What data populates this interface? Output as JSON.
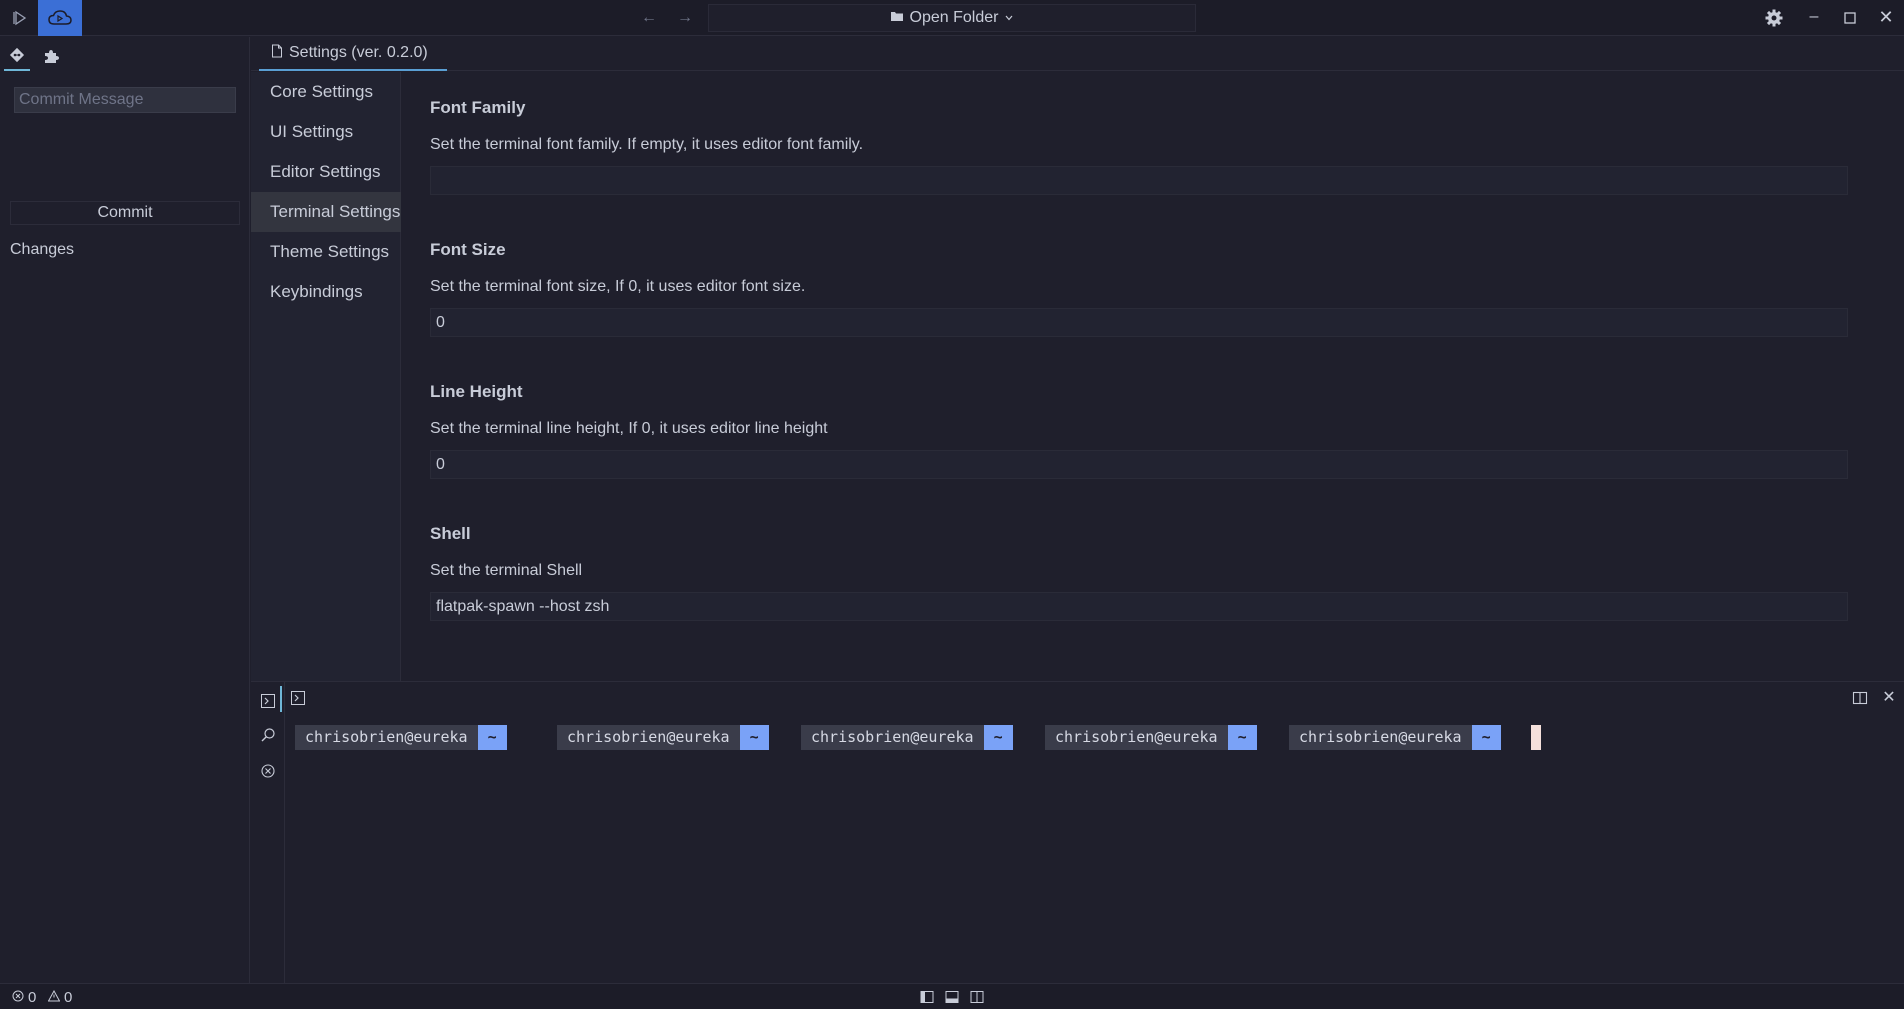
{
  "titlebar": {
    "folder_label": "Open Folder",
    "icons": [
      "run-icon",
      "remote-icon",
      "back-arrow-icon",
      "forward-arrow-icon",
      "folder-icon",
      "chevron-down-icon",
      "gear-icon",
      "minimize-icon",
      "maximize-icon",
      "close-icon"
    ]
  },
  "sidebar": {
    "commit_placeholder": "Commit Message",
    "commit_label": "Commit",
    "changes_label": "Changes"
  },
  "editor": {
    "tab_label": "Settings (ver. 0.2.0)"
  },
  "settings_nav": {
    "items": [
      "Core Settings",
      "UI Settings",
      "Editor Settings",
      "Terminal Settings",
      "Theme Settings",
      "Keybindings"
    ],
    "active": "Terminal Settings"
  },
  "settings": [
    {
      "title": "Font Family",
      "description": "Set the terminal font family. If empty, it uses editor font family.",
      "value": ""
    },
    {
      "title": "Font Size",
      "description": "Set the terminal font size, If 0, it uses editor font size.",
      "value": "0"
    },
    {
      "title": "Line Height",
      "description": "Set the terminal line height, If 0, it uses editor line height",
      "value": "0"
    },
    {
      "title": "Shell",
      "description": "Set the terminal Shell",
      "value": "flatpak-spawn --host zsh"
    }
  ],
  "terminal": {
    "prompts": [
      {
        "user": "chrisobrien@eureka",
        "dir": "~"
      },
      {
        "user": "chrisobrien@eureka",
        "dir": "~"
      },
      {
        "user": "chrisobrien@eureka",
        "dir": "~"
      },
      {
        "user": "chrisobrien@eureka",
        "dir": "~"
      },
      {
        "user": "chrisobrien@eureka",
        "dir": "~"
      }
    ]
  },
  "statusbar": {
    "errors": "0",
    "warnings": "0"
  },
  "colors": {
    "background": "#1f1f2c",
    "accent": "#3b6fd6",
    "prompt_dir": "#7aa2f7",
    "cursor": "#f5e0dc"
  }
}
